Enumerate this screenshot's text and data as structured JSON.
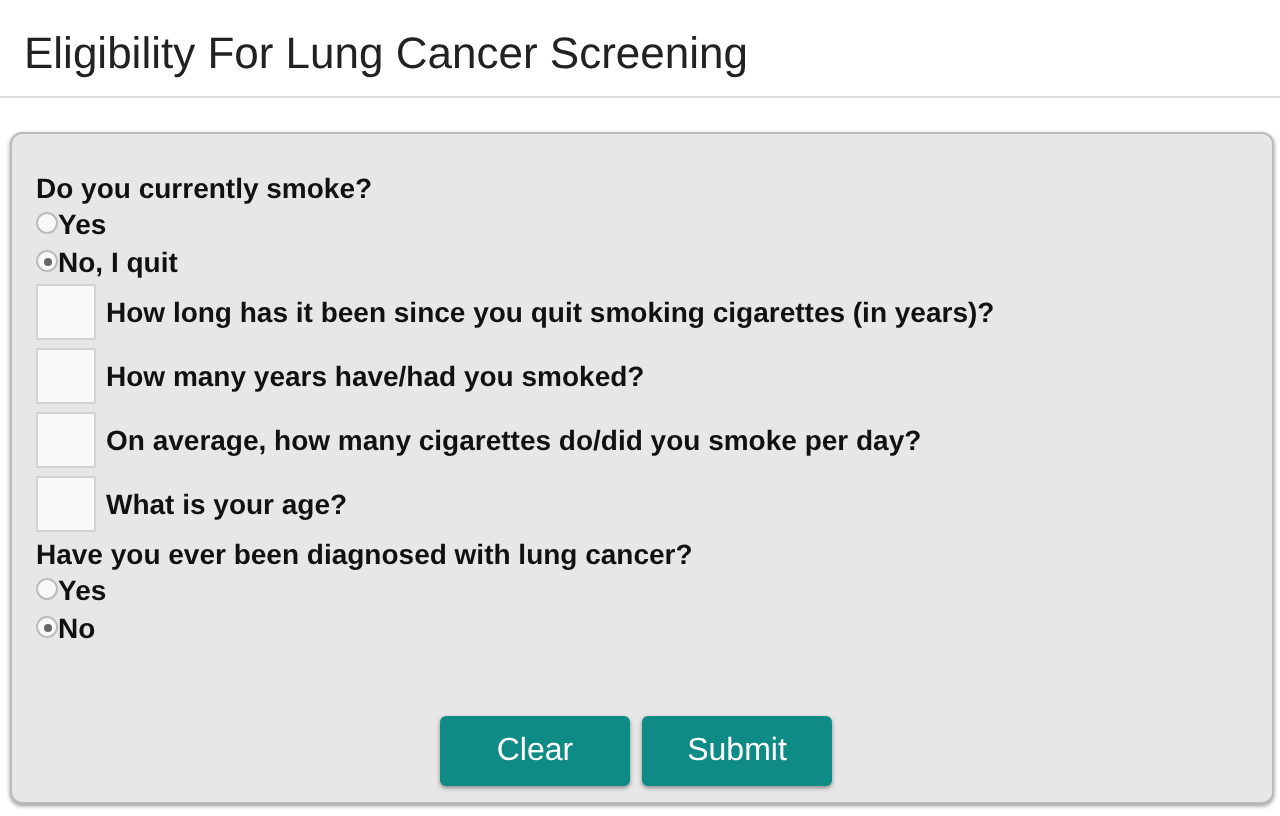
{
  "title": "Eligibility For Lung Cancer Screening",
  "questions": [
    {
      "kind": "radio",
      "label": "Do you currently smoke?",
      "options": [
        {
          "label": "Yes",
          "selected": false
        },
        {
          "label": "No, I quit",
          "selected": true
        }
      ]
    },
    {
      "kind": "number",
      "label": "How long has it been since you quit smoking cigarettes (in years)?"
    },
    {
      "kind": "number",
      "label": "How many years have/had you smoked?"
    },
    {
      "kind": "number",
      "label": "On average, how many cigarettes do/did you smoke per day?"
    },
    {
      "kind": "number",
      "label": "What is your age?"
    },
    {
      "kind": "radio",
      "label": "Have you ever been diagnosed with lung cancer?",
      "options": [
        {
          "label": "Yes",
          "selected": false
        },
        {
          "label": "No",
          "selected": true
        }
      ]
    }
  ],
  "buttons": [
    "Clear",
    "Submit"
  ]
}
